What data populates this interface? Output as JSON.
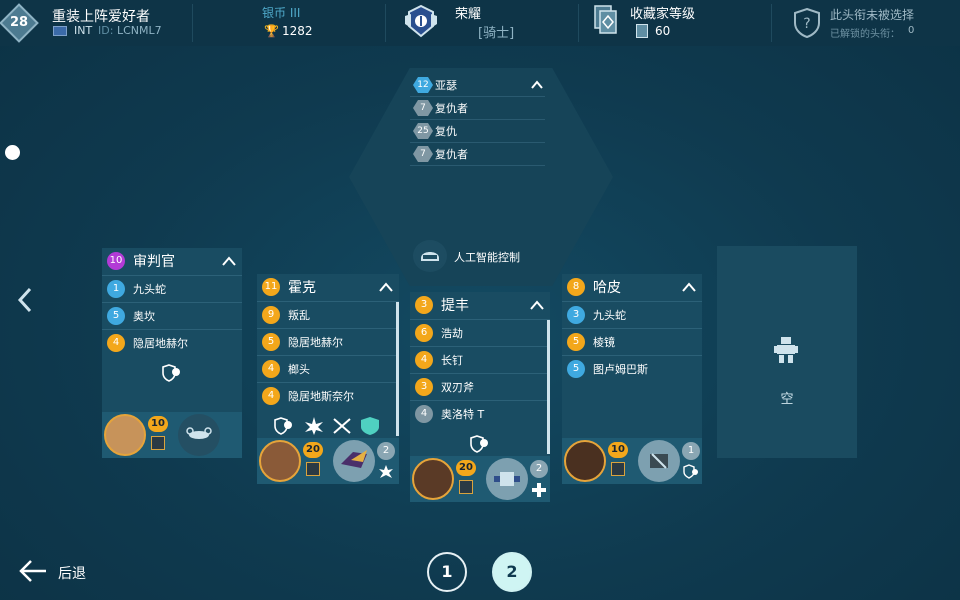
{
  "player": {
    "level": "28",
    "name": "重装上阵爱好者",
    "region": "INT",
    "id_label": "ID:",
    "id_value": "LCNML7"
  },
  "league": {
    "name": "银币 III",
    "trophies": "1282"
  },
  "honor": {
    "title": "荣耀",
    "rank": "[骑士]"
  },
  "collector": {
    "title": "收藏家等级",
    "value": "60"
  },
  "player_title": {
    "text": "此头衔未被选择",
    "unlocked_label": "已解锁的头衔：",
    "unlocked_count": "0"
  },
  "ai_mech": {
    "weapons": [
      {
        "level": "12",
        "name": "亚瑟",
        "color": "#3fa9e0"
      },
      {
        "level": "7",
        "name": "复仇者",
        "color": "#7f97a3"
      },
      {
        "level": "25",
        "name": "复仇",
        "color": "#7f97a3"
      },
      {
        "level": "7",
        "name": "复仇者",
        "color": "#7f97a3"
      }
    ],
    "control_label": "人工智能控制"
  },
  "mechs": [
    {
      "level": "10",
      "level_color": "#b23bd6",
      "name": "审判官",
      "weapons": [
        {
          "level": "1",
          "name": "九头蛇",
          "color": "#3fa9e0"
        },
        {
          "level": "5",
          "name": "奥坎",
          "color": "#3fa9e0"
        },
        {
          "level": "4",
          "name": "隐居地赫尔",
          "color": "#f3a71b"
        }
      ],
      "pilot_level": "10",
      "drone_level": ""
    },
    {
      "level": "11",
      "level_color": "#f3a71b",
      "name": "霍克",
      "weapons": [
        {
          "level": "9",
          "name": "叛乱",
          "color": "#f3a71b"
        },
        {
          "level": "5",
          "name": "隐居地赫尔",
          "color": "#f3a71b"
        },
        {
          "level": "4",
          "name": "榔头",
          "color": "#f3a71b"
        },
        {
          "level": "4",
          "name": "隐居地斯奈尔",
          "color": "#f3a71b"
        }
      ],
      "pilot_level": "20",
      "drone_level": "2"
    },
    {
      "level": "3",
      "level_color": "#f3a71b",
      "name": "提丰",
      "weapons": [
        {
          "level": "6",
          "name": "浩劫",
          "color": "#f3a71b"
        },
        {
          "level": "4",
          "name": "长钉",
          "color": "#f3a71b"
        },
        {
          "level": "3",
          "name": "双刃斧",
          "color": "#f3a71b"
        },
        {
          "level": "4",
          "name": "奥洛特 T",
          "color": "#7f97a3"
        }
      ],
      "pilot_level": "20",
      "drone_level": "2"
    },
    {
      "level": "8",
      "level_color": "#f3a71b",
      "name": "哈皮",
      "weapons": [
        {
          "level": "3",
          "name": "九头蛇",
          "color": "#3fa9e0"
        },
        {
          "level": "5",
          "name": "棱镜",
          "color": "#f3a71b"
        },
        {
          "level": "5",
          "name": "图卢姆巴斯",
          "color": "#3fa9e0"
        }
      ],
      "pilot_level": "10",
      "drone_level": "1"
    }
  ],
  "empty_slot": {
    "label": "空"
  },
  "footer": {
    "back_label": "后退",
    "pages": [
      "1",
      "2"
    ]
  },
  "icons": {
    "gear_shield": "shield-gear-icon",
    "back": "arrow-left-icon",
    "nav_prev": "chevron-left-icon"
  }
}
